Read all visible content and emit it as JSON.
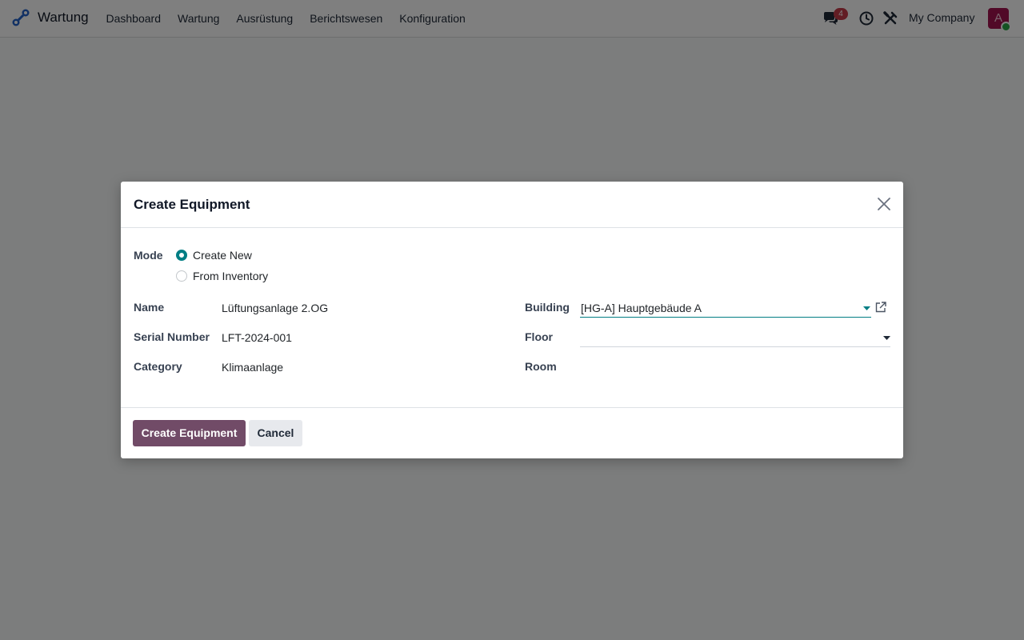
{
  "navbar": {
    "app_name": "Wartung",
    "menu": [
      "Dashboard",
      "Wartung",
      "Ausrüstung",
      "Berichtswesen",
      "Konfiguration"
    ],
    "message_count": "4",
    "company": "My Company",
    "avatar_initial": "A"
  },
  "dialog": {
    "title": "Create Equipment",
    "mode_label": "Mode",
    "mode_options": [
      "Create New",
      "From Inventory"
    ],
    "mode_selected": "Create New",
    "fields_left": [
      {
        "label": "Name",
        "value": "Lüftungsanlage 2.OG"
      },
      {
        "label": "Serial Number",
        "value": "LFT-2024-001"
      },
      {
        "label": "Category",
        "value": "Klimaanlage"
      }
    ],
    "fields_right": [
      {
        "label": "Building",
        "value": "[HG-A] Hauptgebäude A"
      },
      {
        "label": "Floor",
        "value": ""
      },
      {
        "label": "Room",
        "value": ""
      }
    ],
    "primary_button": "Create Equipment",
    "secondary_button": "Cancel"
  },
  "colors": {
    "accent_teal": "#017e84",
    "primary_button": "#714b67",
    "badge": "#c43a48",
    "avatar": "#a3124f"
  },
  "icons": [
    "app-logo-icon",
    "chat-icon",
    "clock-icon",
    "tools-icon",
    "close-icon",
    "dropdown-caret-icon",
    "external-link-icon"
  ]
}
